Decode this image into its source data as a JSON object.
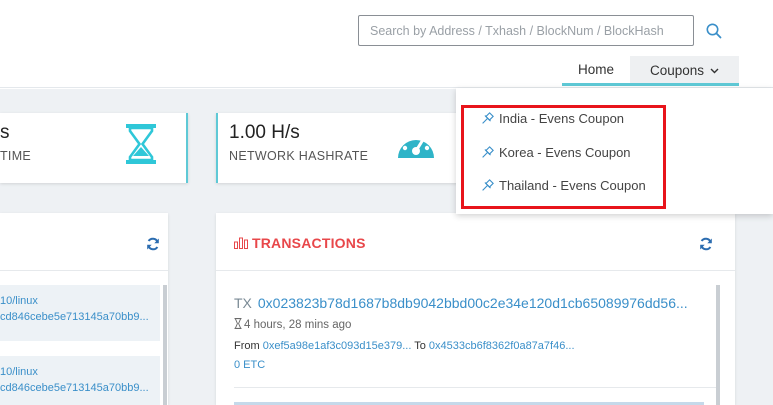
{
  "header": {
    "search": {
      "placeholder": "Search by Address / Txhash / BlockNum / BlockHash",
      "value": ""
    },
    "nav": {
      "home": "Home",
      "coupons": "Coupons"
    }
  },
  "stats": {
    "left": {
      "value": "s",
      "label": "TIME"
    },
    "hashrate": {
      "value": "1.00 H/s",
      "label": "NETWORK HASHRATE"
    }
  },
  "left_panel": {
    "rows": [
      {
        "line1": "10/linux",
        "line2": "cd846cebe5e713145a70bb9..."
      },
      {
        "line1": "10/linux",
        "line2": "cd846cebe5e713145a70bb9..."
      }
    ]
  },
  "transactions": {
    "title": "TRANSACTIONS",
    "items": [
      {
        "prefix": "TX",
        "hash": "0x023823b78d1687b8db9042bbd00c2e34e120d1cb65089976dd56...",
        "time": "4 hours, 28 mins ago",
        "from_label": "From",
        "from": "0xef5a98e1af3c093d15e379...",
        "to_label": "To",
        "to": "0x4533cb6f8362f0a87a7f46...",
        "amount": "0 ETC"
      }
    ]
  },
  "dropdown": {
    "items": [
      {
        "label": "India - Evens Coupon"
      },
      {
        "label": "Korea - Evens Coupon"
      },
      {
        "label": "Thailand - Evens Coupon"
      }
    ]
  },
  "colors": {
    "accent": "#5fc9d6",
    "link": "#3a8fc9",
    "transactions_title": "#e8474a",
    "highlight": "#e8141b"
  },
  "icons": {
    "search": "search-icon",
    "chevron": "chevron-down-icon",
    "hourglass": "hourglass-icon",
    "gauge": "gauge-icon",
    "refresh": "refresh-icon",
    "bar_chart": "bar-chart-icon",
    "pin": "pushpin-icon"
  }
}
